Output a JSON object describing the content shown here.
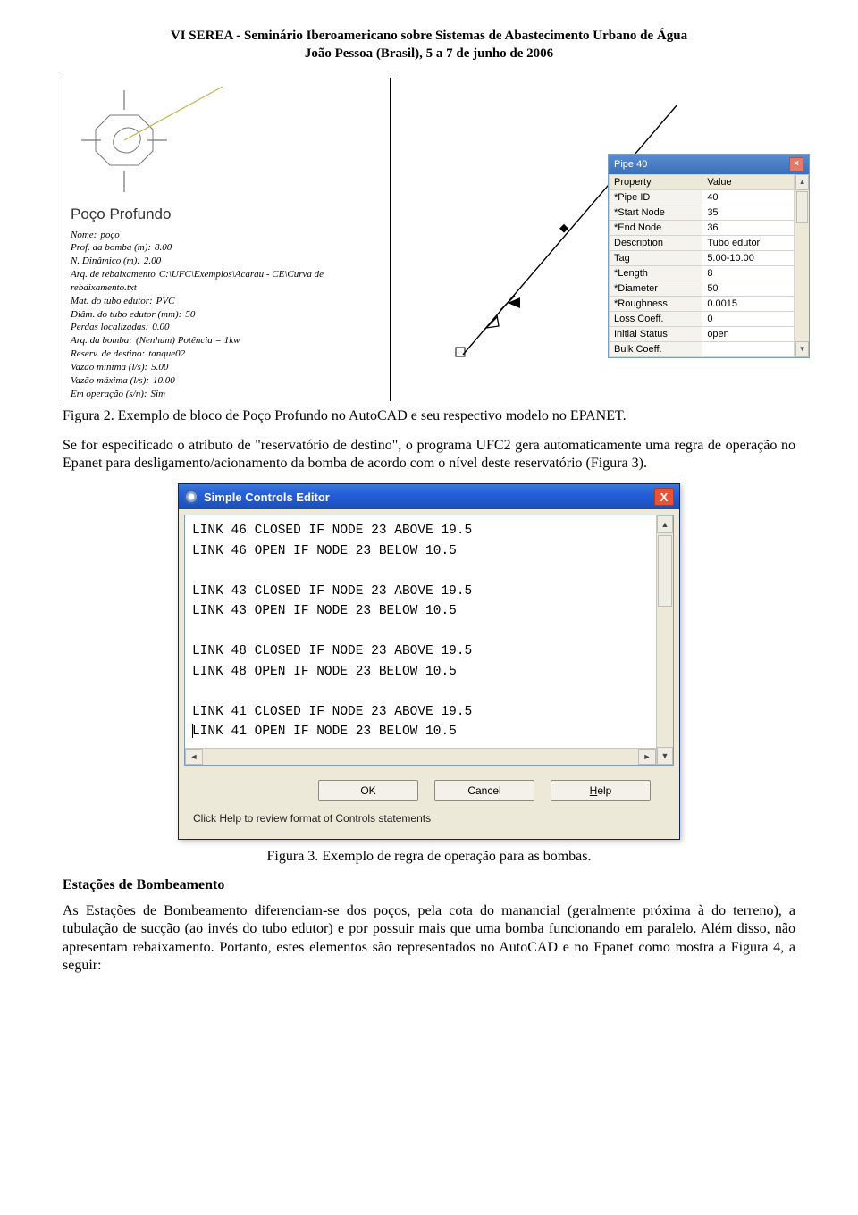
{
  "header": {
    "line1": "VI SEREA - Seminário Iberoamericano sobre Sistemas de Abastecimento Urbano de Água",
    "line2": "João Pessoa (Brasil), 5 a 7 de junho de 2006"
  },
  "well": {
    "title": "Poço Profundo",
    "rows": [
      {
        "k": "Nome:",
        "v": "poço"
      },
      {
        "k": "Prof. da bomba (m):",
        "v": "8.00"
      },
      {
        "k": "N. Dinâmico (m):",
        "v": "2.00"
      },
      {
        "k": "Arq. de rebaixamento",
        "v": "C:\\UFC\\Exemplos\\Acarau - CE\\Curva de rebaixamento.txt"
      },
      {
        "k": "Mat. do tubo edutor:",
        "v": "PVC"
      },
      {
        "k": "Diâm. do tubo edutor (mm):",
        "v": "50"
      },
      {
        "k": "Perdas localizadas:",
        "v": "0.00"
      },
      {
        "k": "Arq. da bomba:",
        "v": "(Nenhum) Potência = 1kw"
      },
      {
        "k": "Reserv. de destino:",
        "v": "tanque02"
      },
      {
        "k": "Vazão mínima (l/s):",
        "v": "5.00"
      },
      {
        "k": "Vazão máxima (l/s):",
        "v": "10.00"
      },
      {
        "k": "Em operação (s/n):",
        "v": "Sim"
      }
    ]
  },
  "pipe": {
    "tooltip": "Pipe 40",
    "panel_title": "Pipe 40",
    "columns": {
      "prop": "Property",
      "val": "Value"
    },
    "rows": [
      {
        "k": "*Pipe ID",
        "v": "40"
      },
      {
        "k": "*Start Node",
        "v": "35"
      },
      {
        "k": "*End Node",
        "v": "36"
      },
      {
        "k": "Description",
        "v": "Tubo edutor"
      },
      {
        "k": "Tag",
        "v": "5.00-10.00"
      },
      {
        "k": "*Length",
        "v": "8"
      },
      {
        "k": "*Diameter",
        "v": "50"
      },
      {
        "k": "*Roughness",
        "v": "0.0015"
      },
      {
        "k": "Loss Coeff.",
        "v": "0"
      },
      {
        "k": "Initial Status",
        "v": "open"
      },
      {
        "k": "Bulk Coeff.",
        "v": ""
      }
    ]
  },
  "captions": {
    "fig2": "Figura 2. Exemplo de bloco de Poço Profundo no AutoCAD e seu respectivo modelo no EPANET.",
    "fig3": "Figura 3. Exemplo de regra de operação para as bombas."
  },
  "paragraphs": {
    "p1": "Se for especificado o atributo de \"reservatório de destino\", o programa UFC2 gera automaticamente uma regra de operação no Epanet para desligamento/acionamento da bomba de acordo com o nível deste reservatório (Figura 3).",
    "p2": "As Estações de Bombeamento diferenciam-se dos poços, pela cota do manancial (geralmente próxima à do terreno), a tubulação de sucção (ao invés do tubo edutor) e por possuir mais que uma bomba funcionando em paralelo. Além disso, não apresentam rebaixamento. Portanto, estes elementos são representados no AutoCAD e no Epanet como mostra a Figura 4, a seguir:"
  },
  "section": {
    "title": "Estações de Bombeamento"
  },
  "sce": {
    "title": "Simple Controls Editor",
    "lines": [
      "LINK 46 CLOSED IF NODE 23 ABOVE 19.5",
      "LINK 46 OPEN IF NODE 23 BELOW 10.5",
      "",
      "LINK 43 CLOSED IF NODE 23 ABOVE 19.5",
      "LINK 43 OPEN IF NODE 23 BELOW 10.5",
      "",
      "LINK 48 CLOSED IF NODE 23 ABOVE 19.5",
      "LINK 48 OPEN IF NODE 23 BELOW 10.5",
      "",
      "LINK 41 CLOSED IF NODE 23 ABOVE 19.5",
      "LINK 41 OPEN IF NODE 23 BELOW 10.5"
    ],
    "buttons": {
      "ok": "OK",
      "cancel": "Cancel",
      "help": "Help"
    },
    "hint": "Click Help to review format of Controls statements"
  }
}
